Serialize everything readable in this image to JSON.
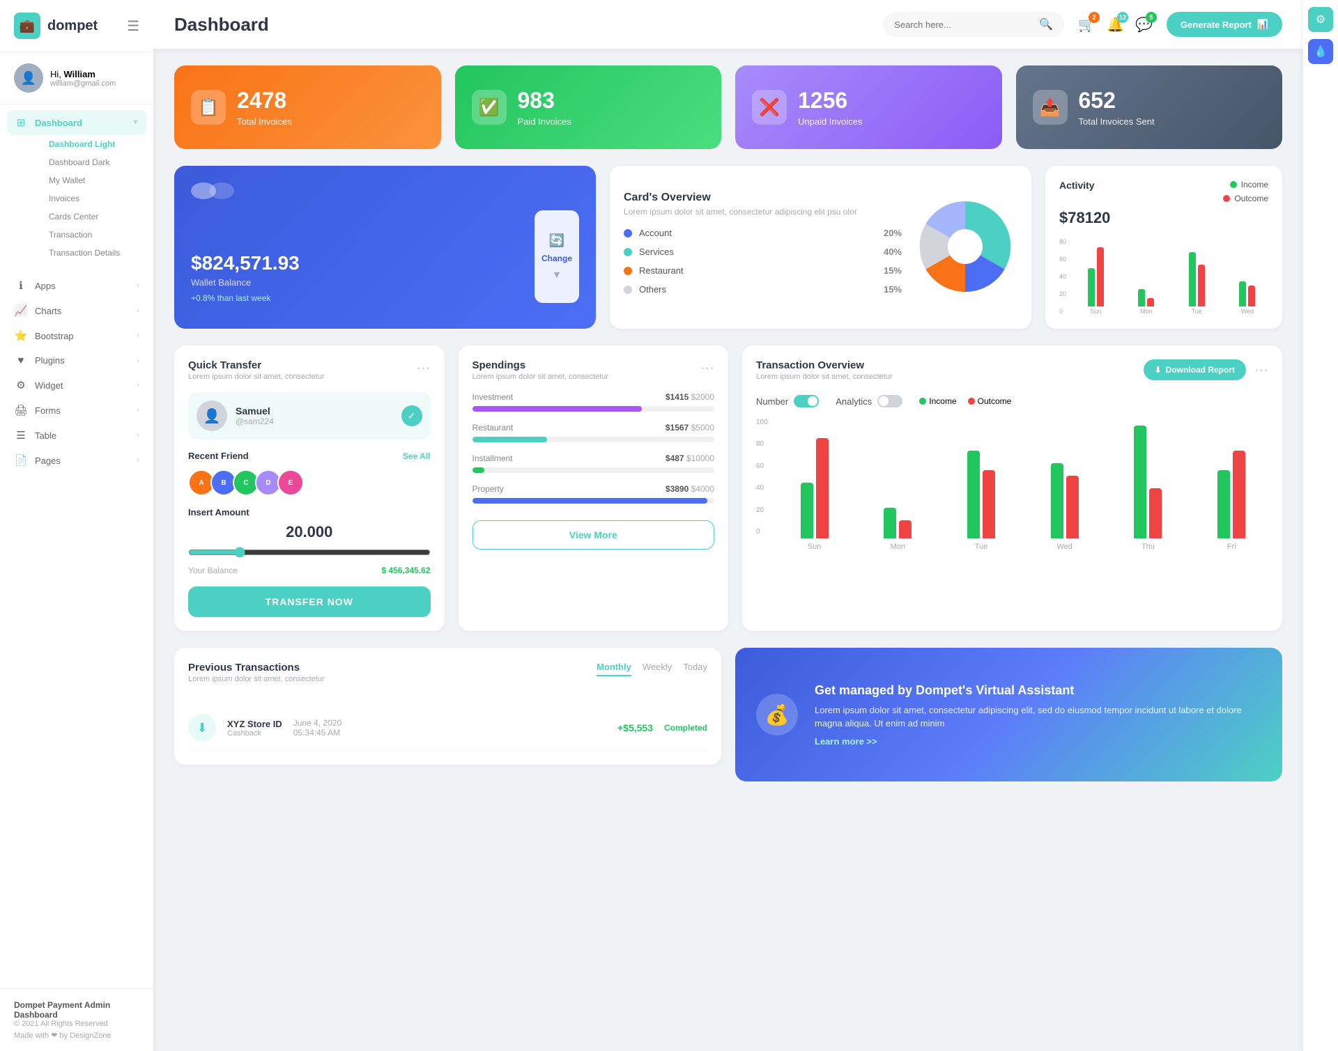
{
  "sidebar": {
    "logo": "dompet",
    "user": {
      "greeting": "Hi,",
      "name": "William",
      "email": "william@gmail.com"
    },
    "nav": {
      "dashboard": {
        "label": "Dashboard",
        "active": true
      },
      "sub_items": [
        {
          "label": "Dashboard Light",
          "active": true
        },
        {
          "label": "Dashboard Dark"
        },
        {
          "label": "My Wallet"
        },
        {
          "label": "Invoices"
        },
        {
          "label": "Cards Center"
        },
        {
          "label": "Transaction"
        },
        {
          "label": "Transaction Details"
        }
      ],
      "items": [
        {
          "label": "Apps",
          "icon": "ℹ"
        },
        {
          "label": "Charts",
          "icon": "📈"
        },
        {
          "label": "Bootstrap",
          "icon": "⭐"
        },
        {
          "label": "Plugins",
          "icon": "♥"
        },
        {
          "label": "Widget",
          "icon": "⚙"
        },
        {
          "label": "Forms",
          "icon": "🖨"
        },
        {
          "label": "Table",
          "icon": "☰"
        },
        {
          "label": "Pages",
          "icon": "📄"
        }
      ]
    },
    "footer": {
      "title": "Dompet Payment Admin Dashboard",
      "copy": "© 2021 All Rights Reserved",
      "made": "Made with ❤ by DesignZone"
    }
  },
  "header": {
    "title": "Dashboard",
    "search_placeholder": "Search here...",
    "generate_btn": "Generate Report",
    "badges": {
      "cart": "2",
      "bell": "12",
      "chat": "5"
    }
  },
  "stats": [
    {
      "number": "2478",
      "label": "Total Invoices",
      "color": "orange",
      "icon": "📋"
    },
    {
      "number": "983",
      "label": "Paid Invoices",
      "color": "green",
      "icon": "✅"
    },
    {
      "number": "1256",
      "label": "Unpaid Invoices",
      "color": "purple",
      "icon": "❌"
    },
    {
      "number": "652",
      "label": "Total Invoices Sent",
      "color": "slate",
      "icon": "📤"
    }
  ],
  "wallet": {
    "amount": "$824,571.93",
    "label": "Wallet Balance",
    "change": "+0.8% than last week",
    "change_btn": "Change"
  },
  "cards_overview": {
    "title": "Card's Overview",
    "subtitle": "Lorem ipsum dolor sit amet, consectetur adipiscing elit psu olor",
    "legend": [
      {
        "label": "Account",
        "pct": "20%",
        "color": "#4c6ef5"
      },
      {
        "label": "Services",
        "pct": "40%",
        "color": "#4dd0c4"
      },
      {
        "label": "Restaurant",
        "pct": "15%",
        "color": "#f97316"
      },
      {
        "label": "Others",
        "pct": "15%",
        "color": "#d1d5db"
      }
    ]
  },
  "activity": {
    "title": "Activity",
    "amount": "$78120",
    "income_label": "Income",
    "outcome_label": "Outcome",
    "chart": {
      "labels": [
        "Sun",
        "Mon",
        "Tue",
        "Wed"
      ],
      "income": [
        45,
        20,
        65,
        30
      ],
      "outcome": [
        70,
        10,
        50,
        25
      ]
    }
  },
  "quick_transfer": {
    "title": "Quick Transfer",
    "subtitle": "Lorem ipsum dolor sit amet, consectetur",
    "user": {
      "name": "Samuel",
      "handle": "@sam224"
    },
    "recent_label": "Recent Friend",
    "see_all": "See All",
    "friends": [
      "A",
      "B",
      "C",
      "D",
      "E"
    ],
    "insert_label": "Insert Amount",
    "amount": "20.000",
    "balance_label": "Your Balance",
    "balance": "$ 456,345.62",
    "transfer_btn": "TRANSFER NOW"
  },
  "spendings": {
    "title": "Spendings",
    "subtitle": "Lorem ipsum dolor sit amet, consectetur",
    "items": [
      {
        "label": "Investment",
        "amount": "$1415",
        "limit": "$2000",
        "pct": 70,
        "color": "#a855f7"
      },
      {
        "label": "Restaurant",
        "amount": "$1567",
        "limit": "$5000",
        "pct": 31,
        "color": "#4dd0c4"
      },
      {
        "label": "Installment",
        "amount": "$487",
        "limit": "$10000",
        "pct": 5,
        "color": "#22c55e"
      },
      {
        "label": "Property",
        "amount": "$3890",
        "limit": "$4000",
        "pct": 97,
        "color": "#4c6ef5"
      }
    ],
    "view_more": "View More"
  },
  "transaction_overview": {
    "title": "Transaction Overview",
    "subtitle": "Lorem ipsum dolor sit amet, consectetur",
    "download_btn": "Download Report",
    "number_label": "Number",
    "analytics_label": "Analytics",
    "income_label": "Income",
    "outcome_label": "Outcome",
    "chart": {
      "labels": [
        "Sun",
        "Mon",
        "Tue",
        "Wed",
        "Thu",
        "Fri"
      ],
      "income": [
        45,
        25,
        70,
        60,
        90,
        55
      ],
      "outcome": [
        80,
        15,
        55,
        50,
        40,
        70
      ]
    },
    "y_axis": [
      "100",
      "80",
      "60",
      "40",
      "20",
      "0"
    ]
  },
  "previous_transactions": {
    "title": "Previous Transactions",
    "subtitle": "Lorem ipsum dolor sit amet, consectetur",
    "tabs": [
      "Monthly",
      "Weekly",
      "Today"
    ],
    "active_tab": "Monthly",
    "rows": [
      {
        "name": "XYZ Store ID",
        "type": "Cashback",
        "date": "June 4, 2020",
        "time": "05:34:45 AM",
        "amount": "+$5,553",
        "status": "Completed",
        "icon": "⬇"
      }
    ]
  },
  "virtual_assistant": {
    "title": "Get managed by Dompet's Virtual Assistant",
    "text": "Lorem ipsum dolor sit amet, consectetur adipiscing elit, sed do eiusmod tempor incidunt ut labore et dolore magna aliqua. Ut enim ad minim",
    "link": "Learn more >>"
  }
}
